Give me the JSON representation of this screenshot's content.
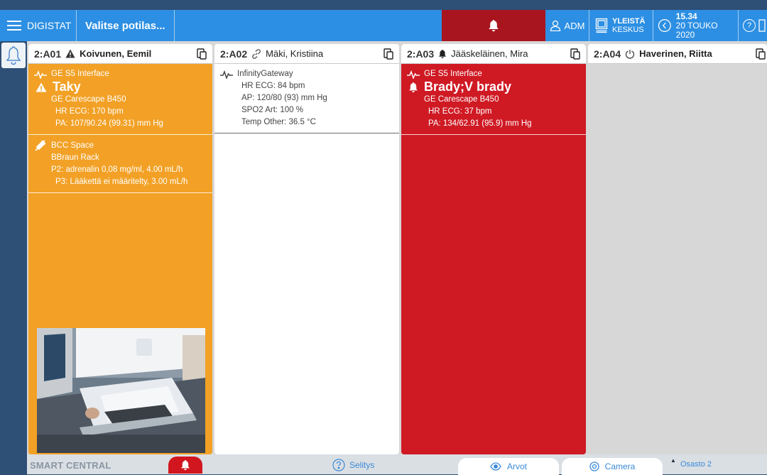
{
  "topbar": {
    "app_name": "DIGISTAT",
    "patient_select": "Valitse potilas...",
    "user": "ADM",
    "ward_line1": "YLEISTÄ",
    "ward_line2": "KESKUS",
    "time": "15.34",
    "date": "20 TOUKO 2020",
    "help_glyph": "?",
    "alarm_color": "#a8151e"
  },
  "cards": [
    {
      "bed": "2:A01",
      "patient": "Koivunen, Eemil",
      "status_icon": "warning-icon",
      "color": "#f2a126",
      "sections": [
        {
          "title": "GE S5 Interface",
          "alarm": "Taky",
          "lines": [
            "GE Carescape B450"
          ],
          "values": [
            "HR ECG: 170  bpm",
            "PA: 107/90.24 (99.31)   mm Hg"
          ]
        },
        {
          "title": "BCC Space",
          "lines": [
            "BBraun Rack"
          ],
          "values": [
            "P2: adrenalin 0,08 mg/ml, 4.00   mL/h",
            "P3: Lääkettä ei määritelty, 3.00   mL/h"
          ]
        }
      ]
    },
    {
      "bed": "2:A02",
      "patient": "Mäki, Kristiina",
      "status_icon": "link-icon",
      "color": "#ffffff",
      "sections": [
        {
          "title": "InfinityGateway",
          "values": [
            "HR ECG: 84  bpm",
            "AP: 120/80 (93)   mm Hg",
            "SPO2 Art: 100  %",
            "Temp Other: 36.5  °C"
          ]
        }
      ]
    },
    {
      "bed": "2:A03",
      "patient": "Jääskeläinen, Mira",
      "status_icon": "bell-icon",
      "color": "#cf1a24",
      "sections": [
        {
          "title": "GE S5 Interface",
          "alarm": "Brady;V brady",
          "lines": [
            "GE Carescape B450"
          ],
          "values": [
            "HR ECG: 37  bpm",
            "PA: 134/62.91 (95.9)    mm Hg"
          ]
        }
      ]
    },
    {
      "bed": "2:A04",
      "patient": "Haverinen, Riitta",
      "status_icon": "power-icon",
      "color": "#d7d7d7",
      "sections": []
    }
  ],
  "bottombar": {
    "title": "SMART CENTRAL",
    "legend": "Selitys",
    "values_tab": "Arvot",
    "camera_tab": "Camera",
    "ward": "Osasto 2"
  }
}
